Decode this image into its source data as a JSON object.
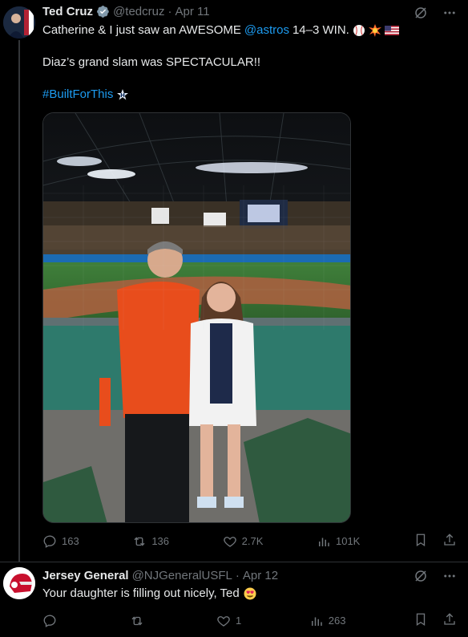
{
  "tweet1": {
    "author": {
      "name": "Ted Cruz",
      "handle": "@tedcruz",
      "separator": "·",
      "date": "Apr 11"
    },
    "text_line1_prefix": "Catherine & I just saw an AWESOME",
    "mention": "@astros",
    "text_line1_suffix": "14–3 WIN.",
    "text_line2": "Diaz’s grand slam was SPECTACULAR!!",
    "hashtag": "#BuiltForThis",
    "media_alt": "Photo at ballpark",
    "stats": {
      "replies": "163",
      "reposts": "136",
      "likes": "2.7K",
      "views": "101K"
    }
  },
  "tweet2": {
    "author": {
      "name": "Jersey General",
      "handle": "@NJGeneralUSFL",
      "separator": "·",
      "date": "Apr 12"
    },
    "text": "Your daughter is filling out nicely, Ted",
    "stats": {
      "replies": "",
      "reposts": "",
      "likes": "1",
      "views": "263"
    }
  },
  "colors": {
    "background": "#000000",
    "text": "#e7e9ea",
    "muted": "#71767b",
    "link": "#1d9bf0",
    "divider": "#2f3336"
  }
}
